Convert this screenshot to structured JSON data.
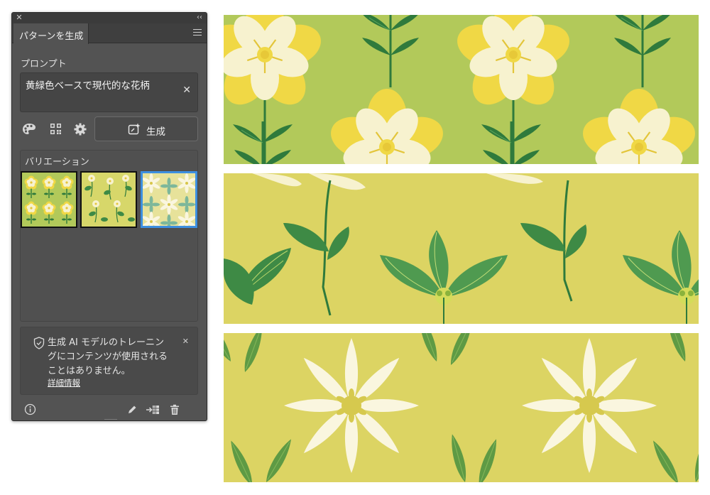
{
  "panel": {
    "tab_title": "パターンを生成",
    "prompt_label": "プロンプト",
    "prompt_value": "黄緑色ベースで現代的な花柄",
    "clear_icon": "close-icon",
    "generate_label": "生成",
    "variations_label": "バリエーション",
    "selected_variation": 3,
    "notice_lines": [
      "生成 AI モデルのトレーニン",
      "グにコンテンツが使用される",
      "ことはありません。"
    ],
    "notice_link": "詳細情報"
  },
  "colors": {
    "panel_bg": "#535353",
    "selection_border": "#3d8fe0",
    "pattern1_bg": "#b2c95a",
    "pattern2_bg": "#dcd463",
    "pattern3_bg": "#dcd463",
    "leaf_green": "#3e8a45",
    "petal_cream": "#f7f2cf",
    "petal_yellow": "#f0d845"
  },
  "icons": {
    "tools": [
      "palette-icon",
      "qr-grid-icon",
      "gear-icon"
    ],
    "bottom": [
      "info-icon",
      "pencil-icon",
      "export-icon",
      "trash-icon"
    ]
  }
}
